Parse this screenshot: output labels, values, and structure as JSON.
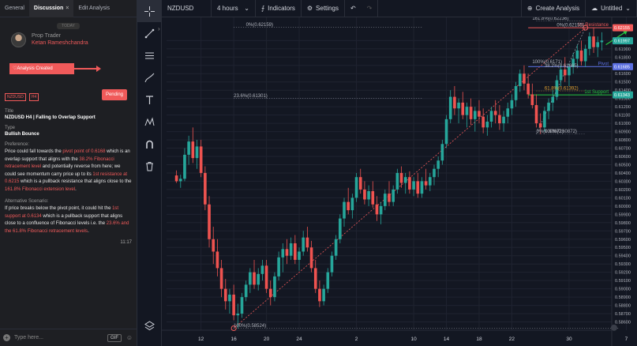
{
  "left_panel": {
    "tabs": [
      {
        "label": "General"
      },
      {
        "label": "Discussion"
      },
      {
        "label": "Edit Analysis"
      }
    ],
    "close_symbol": "×",
    "today_label": "TODAY",
    "author": {
      "role": "Prop Trader",
      "name": "Ketan Rameshchandra"
    },
    "status": "Analysis Created",
    "tags": [
      "NZDUSD",
      "H4"
    ],
    "pending_label": "Pending",
    "title_label": "Title",
    "title_value": "NZDUSD H4 | Falling to Overlap Support",
    "type_label": "Type",
    "type_value": "Bullish Bounce",
    "preference_label": "Preference:",
    "preference": {
      "p1": "Price could fall towards the ",
      "h1": "pivot point of 0.6168",
      "p2": " which is an overlap support that aligns with the ",
      "h2": "38.2% Fibonacci retracement level",
      "p3": " and potentially reverse from here; we could see momentum carry price up to its ",
      "h3": "1st resistance at 0.6215",
      "p4": " which is a pullback resistance that aligns close to the ",
      "h4": "161.8% Fibonacci extension level",
      "p5": "."
    },
    "alternative_label": "Alternative Scenario:",
    "alternative": {
      "p1": "If price breaks below the pivot point, it could hit the ",
      "h1": "1st support at 0.6134",
      "p2": " which is a pullback support that aligns close to a confluence of Fibonacci levels i.e. the ",
      "h2": "23.6% and the 61.8% Fibonacci retracement levels",
      "p3": "."
    },
    "time": "11:17",
    "composer_placeholder": "Type here...",
    "gif_label": "GIF",
    "plus_symbol": "+",
    "emoji_symbol": "☺"
  },
  "toolbar": {
    "collapse_symbol": "›",
    "icons": [
      "crosshair-icon",
      "trend-line-icon",
      "horizontal-lines-icon",
      "brush-icon",
      "text-icon",
      "pattern-icon",
      "magnet-icon",
      "trash-icon"
    ],
    "layers_icon": "layers-icon"
  },
  "topbar": {
    "symbol": "NZDUSD",
    "interval": "4 hours",
    "indicators_label": "Indicators",
    "settings_label": "Settings",
    "create_analysis_label": "Create Analysis",
    "untitled_label": "Untitled",
    "undo_symbol": "↶",
    "redo_symbol": "↷",
    "chevron": "⌄"
  },
  "chart_data": {
    "type": "candlestick",
    "y_ticks": [
      "0.62000",
      "0.61900",
      "0.61800",
      "0.61700",
      "0.61600",
      "0.61500",
      "0.61400",
      "0.61300",
      "0.61200",
      "0.61100",
      "0.61000",
      "0.60900",
      "0.60800",
      "0.60700",
      "0.60600",
      "0.60500",
      "0.60400",
      "0.60300",
      "0.60200",
      "0.60100",
      "0.60000",
      "0.59900",
      "0.59800",
      "0.59700",
      "0.59600",
      "0.59500",
      "0.59400",
      "0.59300",
      "0.59200",
      "0.59100",
      "0.59000",
      "0.58900",
      "0.58800",
      "0.58700",
      "0.58600"
    ],
    "ylim": [
      0.585,
      0.6228
    ],
    "x_ticks": [
      {
        "label": "12",
        "i": 6
      },
      {
        "label": "16",
        "i": 14
      },
      {
        "label": "20",
        "i": 22
      },
      {
        "label": "24",
        "i": 30
      },
      {
        "label": "2",
        "i": 44
      },
      {
        "label": "10",
        "i": 58
      },
      {
        "label": "14",
        "i": 66
      },
      {
        "label": "18",
        "i": 74
      },
      {
        "label": "22",
        "i": 82
      },
      {
        "label": "30",
        "i": 96
      },
      {
        "label": "7",
        "i": 110
      }
    ],
    "price_labels": [
      {
        "value": 0.62155,
        "text": "0.62155",
        "color": "#f05a5a"
      },
      {
        "value": 0.61997,
        "text": "0.61997",
        "color": "#26a69a"
      },
      {
        "value": 0.61685,
        "text": "0.61685",
        "color": "#5b6fe0"
      },
      {
        "value": 0.61343,
        "text": "0.61343",
        "color": "#26a69a"
      }
    ],
    "levels": [
      {
        "name": "1st Resistance",
        "value": 0.62155,
        "color": "#f05a5a"
      },
      {
        "name": "Pivot",
        "value": 0.61685,
        "color": "#5b6fe0"
      },
      {
        "name": "1st Support",
        "value": 0.61343,
        "color": "#26c940"
      }
    ],
    "fib_labels": [
      {
        "text": "0%(0.62159)",
        "value": 0.62159,
        "i": 17,
        "color": "#b2b5be"
      },
      {
        "text": "23.6%(0.61301)",
        "value": 0.61301,
        "i": 14,
        "color": "#b2b5be"
      },
      {
        "text": "100%(0.58524)",
        "value": 0.58524,
        "i": 14,
        "color": "#b2b5be"
      },
      {
        "text": "161.8%(0.62236)",
        "value": 0.62236,
        "i": 87,
        "color": "#b2b5be"
      },
      {
        "text": "0%(0.62155)",
        "value": 0.62155,
        "i": 93,
        "color": "#b2b5be"
      },
      {
        "text": "100%(0.6171)",
        "value": 0.6171,
        "i": 87,
        "color": "#b2b5be"
      },
      {
        "text": "38.2%(0.61665)",
        "value": 0.61665,
        "i": 90,
        "color": "#b2b5be"
      },
      {
        "text": "61.8%(0.61392)",
        "value": 0.61392,
        "i": 90,
        "color": "#e0a030"
      },
      {
        "text": "0%(0.60872)",
        "value": 0.60872,
        "i": 88,
        "color": "#b2b5be"
      },
      {
        "text": "100%(0.60872)",
        "value": 0.60872,
        "i": 90,
        "color": "#b2b5be"
      }
    ],
    "up_color": "#26a69a",
    "down_color": "#ef5350",
    "candles": [
      [
        0.6037,
        0.6043,
        0.6028,
        0.603
      ],
      [
        0.603,
        0.6038,
        0.6022,
        0.6033
      ],
      [
        0.6033,
        0.607,
        0.603,
        0.6062
      ],
      [
        0.6062,
        0.6085,
        0.605,
        0.6078
      ],
      [
        0.6078,
        0.6095,
        0.6052,
        0.6058
      ],
      [
        0.6058,
        0.608,
        0.6045,
        0.6072
      ],
      [
        0.6072,
        0.608,
        0.6035,
        0.604
      ],
      [
        0.604,
        0.6048,
        0.5995,
        0.6002
      ],
      [
        0.6002,
        0.6012,
        0.595,
        0.596
      ],
      [
        0.596,
        0.5975,
        0.593,
        0.5945
      ],
      [
        0.5945,
        0.596,
        0.5915,
        0.5925
      ],
      [
        0.5925,
        0.5935,
        0.589,
        0.59
      ],
      [
        0.59,
        0.5912,
        0.5875,
        0.5885
      ],
      [
        0.5885,
        0.59,
        0.587,
        0.5893
      ],
      [
        0.5893,
        0.5905,
        0.5862,
        0.5868
      ],
      [
        0.5868,
        0.5882,
        0.5852,
        0.587
      ],
      [
        0.587,
        0.5895,
        0.5865,
        0.589
      ],
      [
        0.589,
        0.591,
        0.5885,
        0.5905
      ],
      [
        0.5905,
        0.5925,
        0.5895,
        0.592
      ],
      [
        0.592,
        0.5935,
        0.59,
        0.5905
      ],
      [
        0.5905,
        0.5925,
        0.5898,
        0.5918
      ],
      [
        0.5918,
        0.5935,
        0.591,
        0.5928
      ],
      [
        0.5928,
        0.5935,
        0.5895,
        0.59
      ],
      [
        0.59,
        0.591,
        0.588,
        0.589
      ],
      [
        0.589,
        0.592,
        0.5885,
        0.5915
      ],
      [
        0.5915,
        0.5945,
        0.591,
        0.5938
      ],
      [
        0.5938,
        0.5955,
        0.592,
        0.5948
      ],
      [
        0.5948,
        0.596,
        0.593,
        0.594
      ],
      [
        0.594,
        0.5962,
        0.5935,
        0.5955
      ],
      [
        0.5955,
        0.5965,
        0.593,
        0.5935
      ],
      [
        0.5935,
        0.595,
        0.5922,
        0.5945
      ],
      [
        0.5945,
        0.597,
        0.594,
        0.5962
      ],
      [
        0.5962,
        0.5975,
        0.5945,
        0.595
      ],
      [
        0.595,
        0.5958,
        0.592,
        0.5925
      ],
      [
        0.5925,
        0.5935,
        0.5895,
        0.59
      ],
      [
        0.59,
        0.591,
        0.5878,
        0.5885
      ],
      [
        0.5885,
        0.5905,
        0.588,
        0.59
      ],
      [
        0.59,
        0.5925,
        0.5895,
        0.592
      ],
      [
        0.592,
        0.5945,
        0.5915,
        0.594
      ],
      [
        0.594,
        0.5965,
        0.5935,
        0.596
      ],
      [
        0.596,
        0.599,
        0.5955,
        0.5985
      ],
      [
        0.5985,
        0.601,
        0.5975,
        0.6005
      ],
      [
        0.6005,
        0.6022,
        0.599,
        0.5995
      ],
      [
        0.5995,
        0.6015,
        0.5985,
        0.601
      ],
      [
        0.601,
        0.604,
        0.6005,
        0.6035
      ],
      [
        0.6035,
        0.6045,
        0.6015,
        0.602
      ],
      [
        0.602,
        0.603,
        0.6002,
        0.6008
      ],
      [
        0.6008,
        0.6025,
        0.6,
        0.6018
      ],
      [
        0.6018,
        0.603,
        0.5998,
        0.6002
      ],
      [
        0.6002,
        0.6012,
        0.5982,
        0.599
      ],
      [
        0.599,
        0.6005,
        0.5978,
        0.6
      ],
      [
        0.6,
        0.602,
        0.5995,
        0.6015
      ],
      [
        0.6015,
        0.603,
        0.6,
        0.6005
      ],
      [
        0.6005,
        0.6025,
        0.6,
        0.602
      ],
      [
        0.602,
        0.6045,
        0.6015,
        0.604
      ],
      [
        0.604,
        0.6048,
        0.6022,
        0.6028
      ],
      [
        0.6028,
        0.604,
        0.6015,
        0.6035
      ],
      [
        0.6035,
        0.6042,
        0.6015,
        0.602
      ],
      [
        0.602,
        0.6035,
        0.6012,
        0.603
      ],
      [
        0.603,
        0.604,
        0.601,
        0.6015
      ],
      [
        0.6015,
        0.6035,
        0.601,
        0.603
      ],
      [
        0.603,
        0.6045,
        0.602,
        0.6025
      ],
      [
        0.6025,
        0.604,
        0.6018,
        0.6035
      ],
      [
        0.6035,
        0.605,
        0.6025,
        0.6045
      ],
      [
        0.6045,
        0.606,
        0.6035,
        0.6055
      ],
      [
        0.6055,
        0.608,
        0.605,
        0.6075
      ],
      [
        0.6075,
        0.611,
        0.607,
        0.6105
      ],
      [
        0.6105,
        0.614,
        0.61,
        0.6132
      ],
      [
        0.6132,
        0.6145,
        0.611,
        0.6118
      ],
      [
        0.6118,
        0.613,
        0.61,
        0.6125
      ],
      [
        0.6125,
        0.6138,
        0.6105,
        0.611
      ],
      [
        0.611,
        0.6125,
        0.6095,
        0.612
      ],
      [
        0.612,
        0.613,
        0.6098,
        0.6105
      ],
      [
        0.6105,
        0.612,
        0.609,
        0.6115
      ],
      [
        0.6115,
        0.6128,
        0.61,
        0.6108
      ],
      [
        0.6108,
        0.6118,
        0.6088,
        0.6095
      ],
      [
        0.6095,
        0.611,
        0.6085,
        0.6102
      ],
      [
        0.6102,
        0.612,
        0.6095,
        0.6115
      ],
      [
        0.6115,
        0.6128,
        0.61,
        0.611
      ],
      [
        0.611,
        0.6122,
        0.6092,
        0.61
      ],
      [
        0.61,
        0.6115,
        0.609,
        0.6108
      ],
      [
        0.6108,
        0.6125,
        0.61,
        0.6118
      ],
      [
        0.6118,
        0.6135,
        0.611,
        0.6128
      ],
      [
        0.6128,
        0.615,
        0.612,
        0.6145
      ],
      [
        0.6145,
        0.6165,
        0.6138,
        0.616
      ],
      [
        0.616,
        0.617,
        0.614,
        0.6148
      ],
      [
        0.6148,
        0.616,
        0.613,
        0.6135
      ],
      [
        0.6135,
        0.6148,
        0.6118,
        0.6122
      ],
      [
        0.6122,
        0.6135,
        0.6095,
        0.61
      ],
      [
        0.61,
        0.6112,
        0.6087,
        0.6095
      ],
      [
        0.6095,
        0.612,
        0.609,
        0.6115
      ],
      [
        0.6115,
        0.613,
        0.6105,
        0.6125
      ],
      [
        0.6125,
        0.614,
        0.6115,
        0.6132
      ],
      [
        0.6132,
        0.6158,
        0.6128,
        0.6152
      ],
      [
        0.6152,
        0.617,
        0.6145,
        0.6165
      ],
      [
        0.6165,
        0.618,
        0.615,
        0.6158
      ],
      [
        0.6158,
        0.6172,
        0.6145,
        0.6168
      ],
      [
        0.6168,
        0.6185,
        0.616,
        0.6178
      ],
      [
        0.6178,
        0.6195,
        0.6168,
        0.6188
      ],
      [
        0.6188,
        0.62,
        0.617,
        0.6175
      ],
      [
        0.6175,
        0.6195,
        0.6168,
        0.619
      ],
      [
        0.619,
        0.621,
        0.6182,
        0.6205
      ],
      [
        0.6205,
        0.6216,
        0.6185,
        0.6192
      ],
      [
        0.6192,
        0.6205,
        0.618,
        0.6198
      ],
      [
        0.6198,
        0.621,
        0.6188,
        0.62
      ]
    ]
  }
}
